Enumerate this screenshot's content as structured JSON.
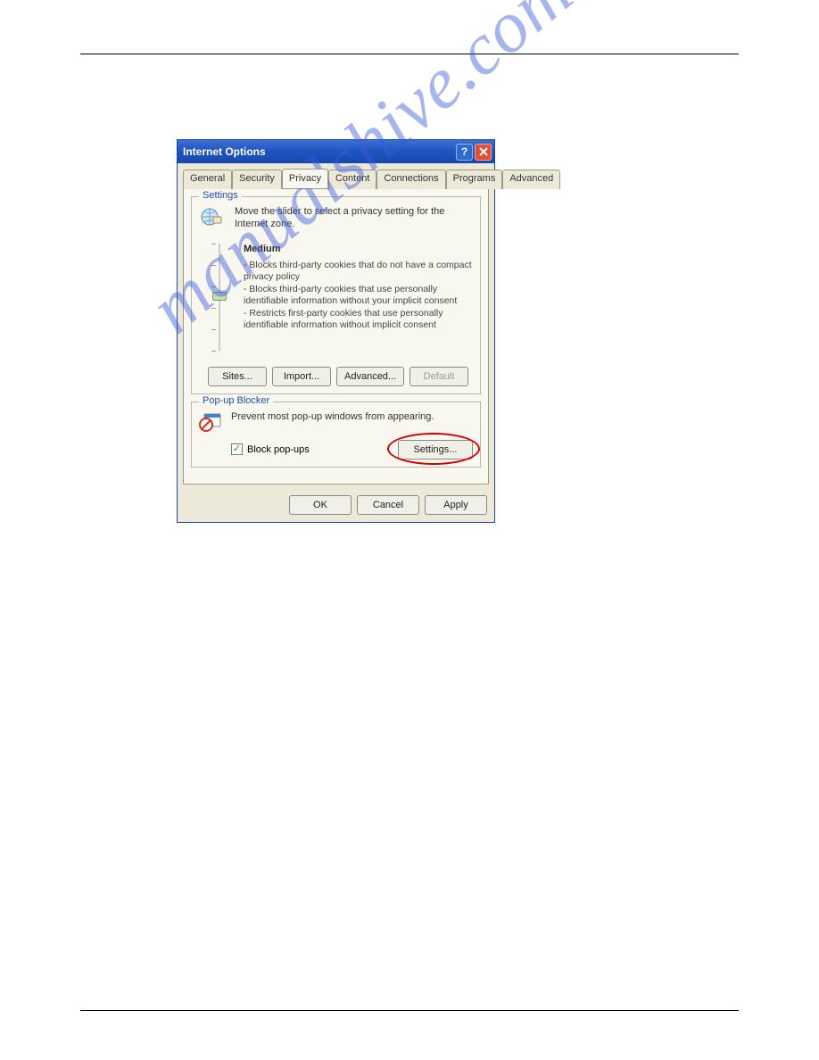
{
  "dialog": {
    "title": "Internet Options",
    "tabs": [
      "General",
      "Security",
      "Privacy",
      "Content",
      "Connections",
      "Programs",
      "Advanced"
    ],
    "active_tab": "Privacy"
  },
  "settings_group": {
    "label": "Settings",
    "instruction": "Move the slider to select a privacy setting for the Internet zone.",
    "level_name": "Medium",
    "bullets": [
      "- Blocks third-party cookies that do not have a compact privacy policy",
      "- Blocks third-party cookies that use personally identifiable information without your implicit consent",
      "- Restricts first-party cookies that use personally identifiable information without implicit consent"
    ],
    "buttons": {
      "sites": "Sites...",
      "import": "Import...",
      "advanced": "Advanced...",
      "default": "Default"
    }
  },
  "popup_group": {
    "label": "Pop-up Blocker",
    "instruction": "Prevent most pop-up windows from appearing.",
    "checkbox_label": "Block pop-ups",
    "checkbox_checked": true,
    "settings_button": "Settings..."
  },
  "dialog_buttons": {
    "ok": "OK",
    "cancel": "Cancel",
    "apply": "Apply"
  },
  "watermark": "manualshive.com"
}
